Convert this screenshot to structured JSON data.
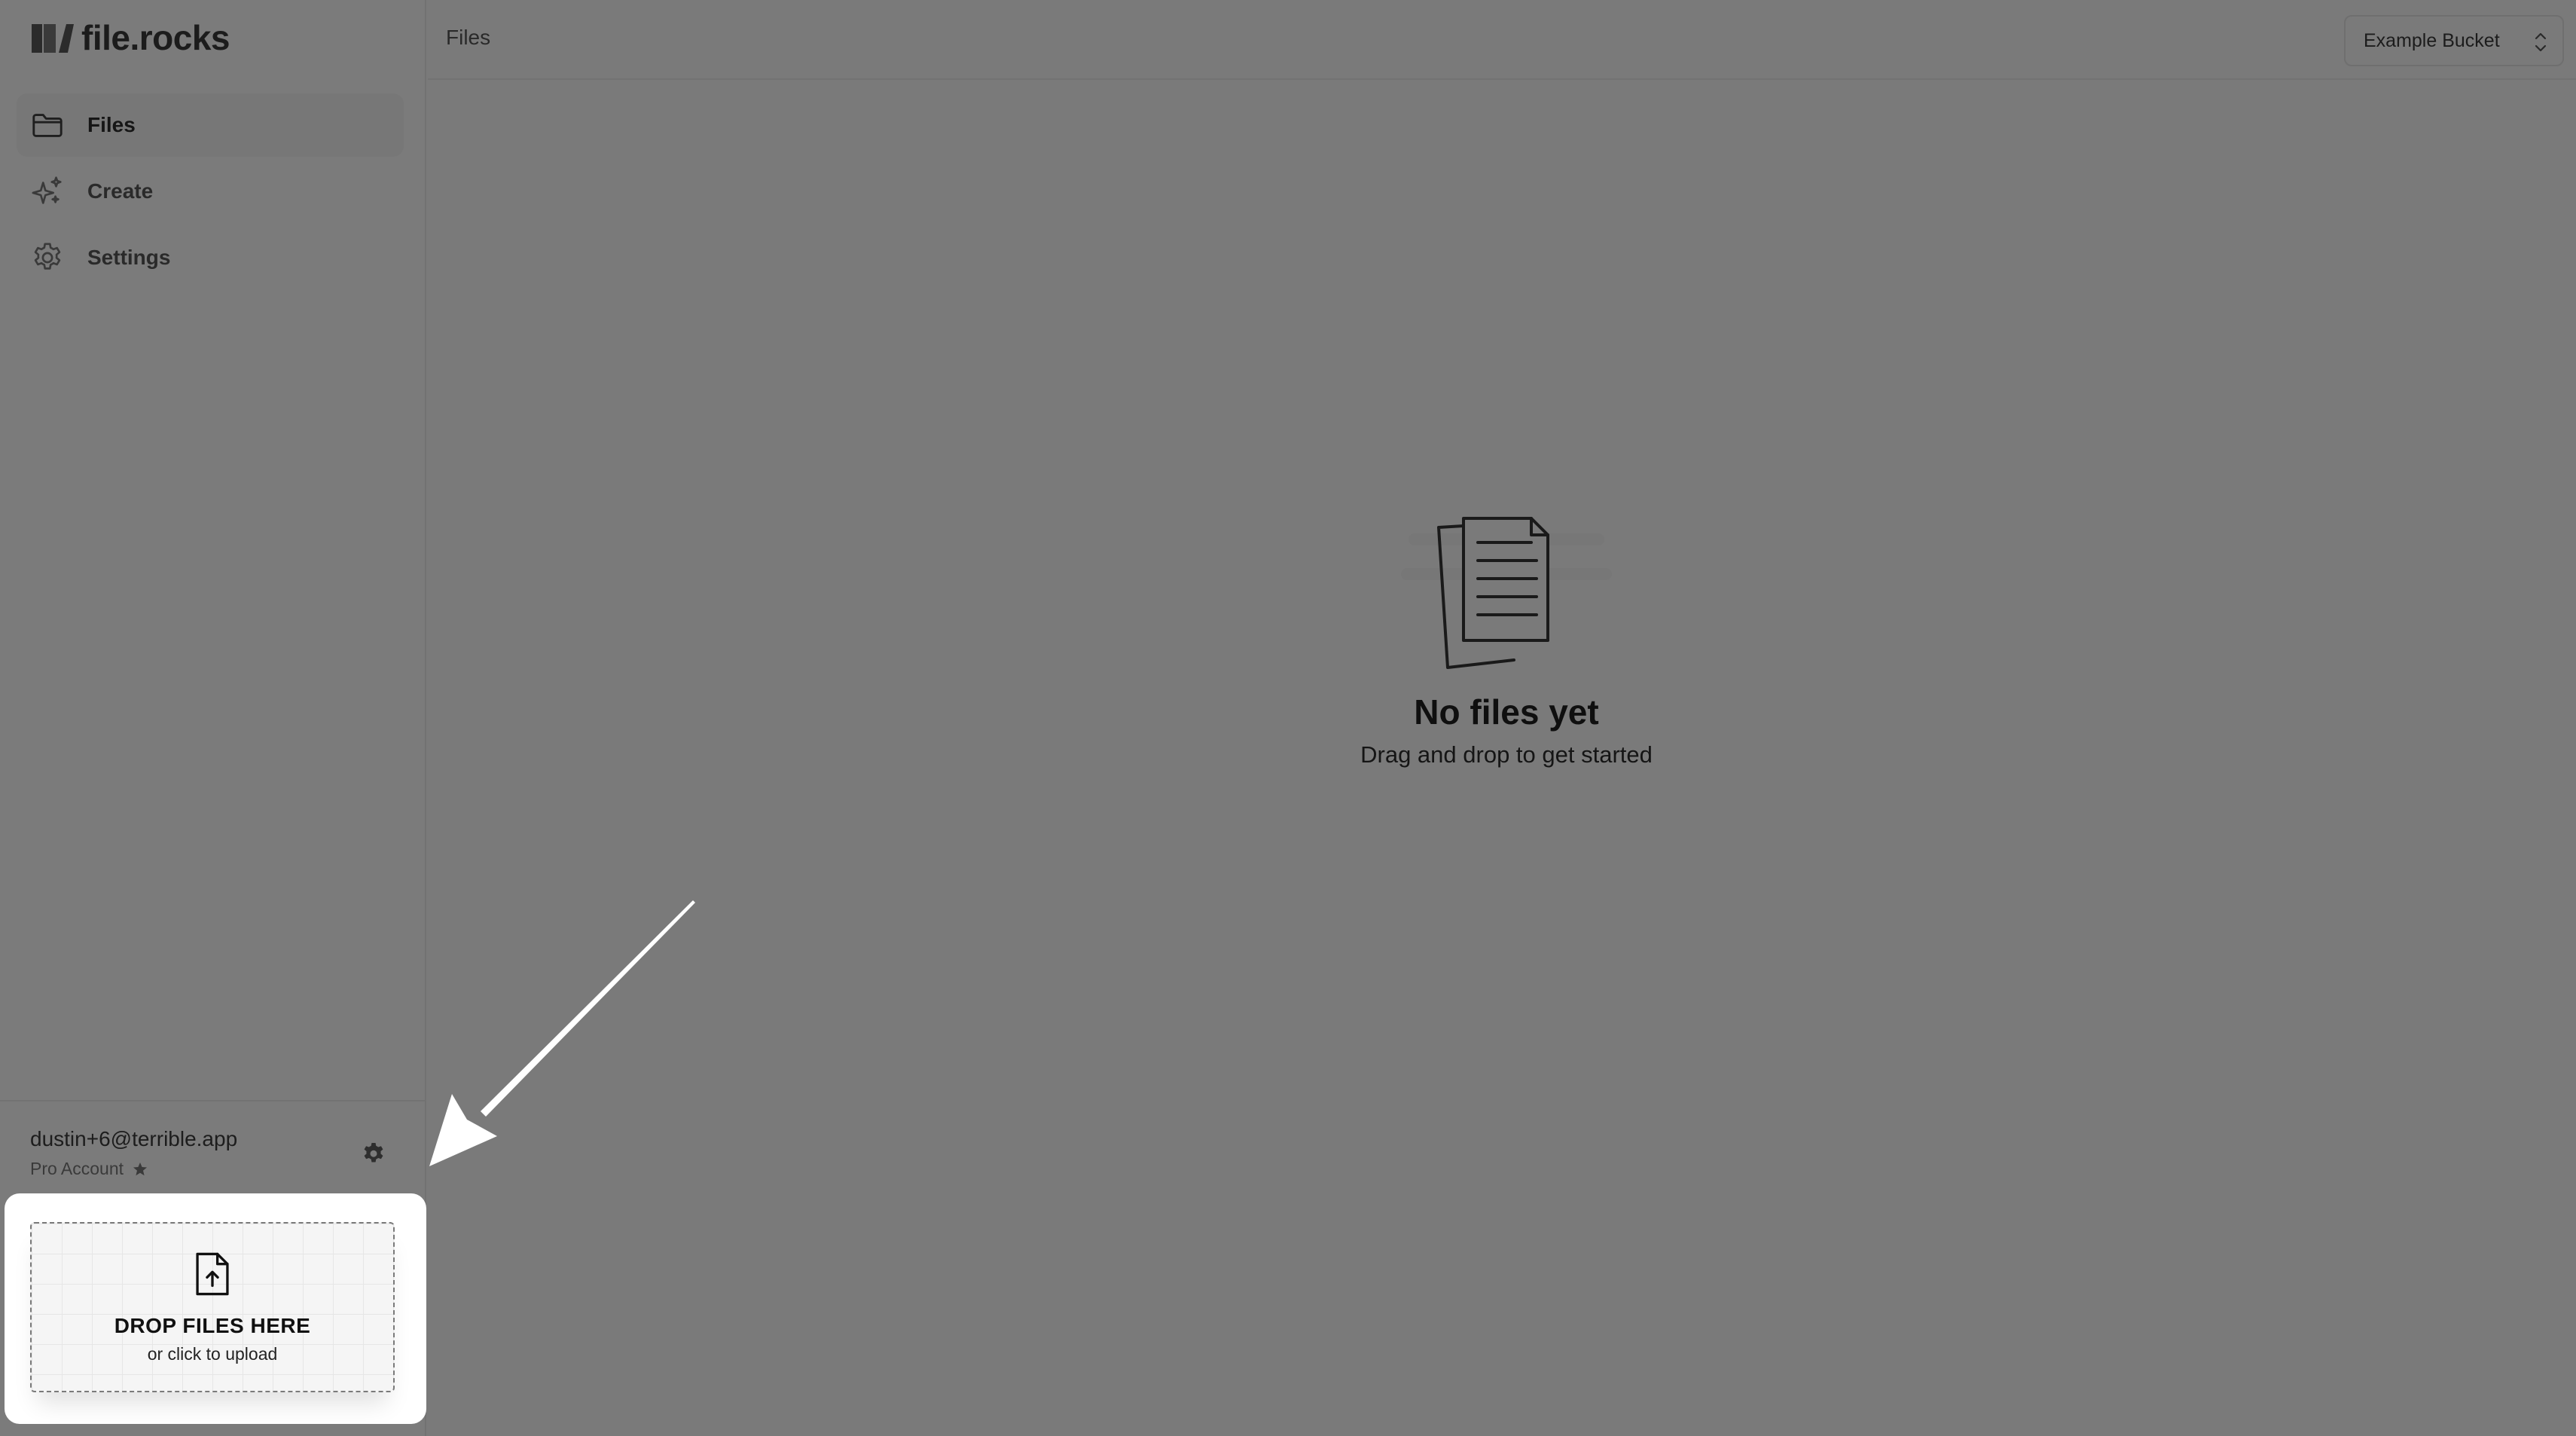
{
  "app": {
    "name": "file.rocks"
  },
  "sidebar": {
    "items": [
      {
        "label": "Files",
        "icon": "folder-icon",
        "active": true
      },
      {
        "label": "Create",
        "icon": "sparkles-icon",
        "active": false
      },
      {
        "label": "Settings",
        "icon": "gear-icon",
        "active": false
      }
    ]
  },
  "account": {
    "email": "dustin+6@terrible.app",
    "plan": "Pro Account",
    "plan_icon": "star-icon",
    "settings_icon": "gear-icon"
  },
  "upload": {
    "title": "DROP FILES HERE",
    "subtitle": "or click to upload",
    "icon": "file-upload-icon"
  },
  "header": {
    "title": "Files",
    "bucket": "Example Bucket",
    "bucket_icon": "chevron-up-down-icon"
  },
  "empty_state": {
    "title": "No files yet",
    "subtitle": "Drag and drop to get started",
    "icon": "documents-icon"
  },
  "colors": {
    "overlay": "#7a7a7a",
    "highlight_card": "#ffffff",
    "text": "#111111",
    "arrow": "#ffffff"
  }
}
